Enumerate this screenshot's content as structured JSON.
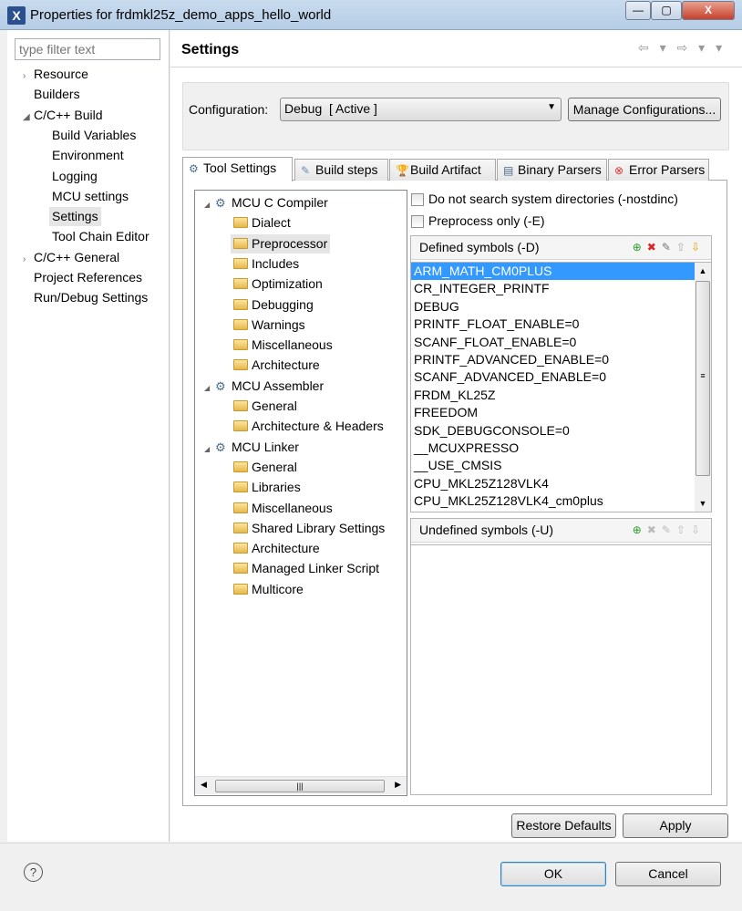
{
  "window": {
    "title": "Properties for frdmkl25z_demo_apps_hello_world",
    "minimize": "—",
    "maximize": "▢",
    "close": "X"
  },
  "filter": {
    "placeholder": "type filter text"
  },
  "nav_tree": [
    {
      "label": "Resource",
      "level": 0,
      "toggle": "›"
    },
    {
      "label": "Builders",
      "level": 0,
      "toggle": ""
    },
    {
      "label": "C/C++ Build",
      "level": 0,
      "toggle": "◢"
    },
    {
      "label": "Build Variables",
      "level": 1,
      "toggle": ""
    },
    {
      "label": "Environment",
      "level": 1,
      "toggle": ""
    },
    {
      "label": "Logging",
      "level": 1,
      "toggle": ""
    },
    {
      "label": "MCU settings",
      "level": 1,
      "toggle": ""
    },
    {
      "label": "Settings",
      "level": 1,
      "toggle": "",
      "selected": true
    },
    {
      "label": "Tool Chain Editor",
      "level": 1,
      "toggle": ""
    },
    {
      "label": "C/C++ General",
      "level": 0,
      "toggle": "›"
    },
    {
      "label": "Project References",
      "level": 0,
      "toggle": ""
    },
    {
      "label": "Run/Debug Settings",
      "level": 0,
      "toggle": ""
    }
  ],
  "page": {
    "title": "Settings",
    "nav": "⇦ ▾ ⇨ ▾ ▾"
  },
  "config": {
    "label": "Configuration:",
    "value": "Debug  [ Active ]",
    "manage_button": "Manage Configurations..."
  },
  "tabs": [
    {
      "label": "Tool Settings",
      "icon": "tool-settings-icon",
      "glyph": "⚙",
      "active": true
    },
    {
      "label": "Build steps",
      "icon": "build-steps-icon",
      "glyph": "✎"
    },
    {
      "label": "Build Artifact",
      "icon": "build-artifact-icon",
      "glyph": "🏆"
    },
    {
      "label": "Binary Parsers",
      "icon": "binary-parsers-icon",
      "glyph": "▤"
    },
    {
      "label": "Error Parsers",
      "icon": "error-parsers-icon",
      "glyph": "⊗"
    }
  ],
  "tool_tree": [
    {
      "label": "MCU C Compiler",
      "type": "tool"
    },
    {
      "label": "Dialect",
      "type": "option"
    },
    {
      "label": "Preprocessor",
      "type": "option",
      "selected": true
    },
    {
      "label": "Includes",
      "type": "option"
    },
    {
      "label": "Optimization",
      "type": "option"
    },
    {
      "label": "Debugging",
      "type": "option"
    },
    {
      "label": "Warnings",
      "type": "option"
    },
    {
      "label": "Miscellaneous",
      "type": "option"
    },
    {
      "label": "Architecture",
      "type": "option"
    },
    {
      "label": "MCU Assembler",
      "type": "tool"
    },
    {
      "label": "General",
      "type": "option"
    },
    {
      "label": "Architecture & Headers",
      "type": "option"
    },
    {
      "label": "MCU Linker",
      "type": "tool"
    },
    {
      "label": "General",
      "type": "option"
    },
    {
      "label": "Libraries",
      "type": "option"
    },
    {
      "label": "Miscellaneous",
      "type": "option"
    },
    {
      "label": "Shared Library Settings",
      "type": "option"
    },
    {
      "label": "Architecture",
      "type": "option"
    },
    {
      "label": "Managed Linker Script",
      "type": "option"
    },
    {
      "label": "Multicore",
      "type": "option"
    }
  ],
  "options": {
    "nostdinc": {
      "label": "Do not search system directories (-nostdinc)",
      "checked": false
    },
    "preprocess_only": {
      "label": "Preprocess only (-E)",
      "checked": false
    }
  },
  "defined": {
    "title": "Defined symbols (-D)",
    "symbols": [
      "ARM_MATH_CM0PLUS",
      "CR_INTEGER_PRINTF",
      "DEBUG",
      "PRINTF_FLOAT_ENABLE=0",
      "SCANF_FLOAT_ENABLE=0",
      "PRINTF_ADVANCED_ENABLE=0",
      "SCANF_ADVANCED_ENABLE=0",
      "FRDM_KL25Z",
      "FREEDOM",
      "SDK_DEBUGCONSOLE=0",
      "__MCUXPRESSO",
      "__USE_CMSIS",
      "CPU_MKL25Z128VLK4",
      "CPU_MKL25Z128VLK4_cm0plus"
    ],
    "selected_index": 0
  },
  "undefined": {
    "title": "Undefined symbols (-U)",
    "symbols": []
  },
  "buttons": {
    "restore": "Restore Defaults",
    "apply": "Apply",
    "ok": "OK",
    "cancel": "Cancel",
    "help": "?"
  }
}
